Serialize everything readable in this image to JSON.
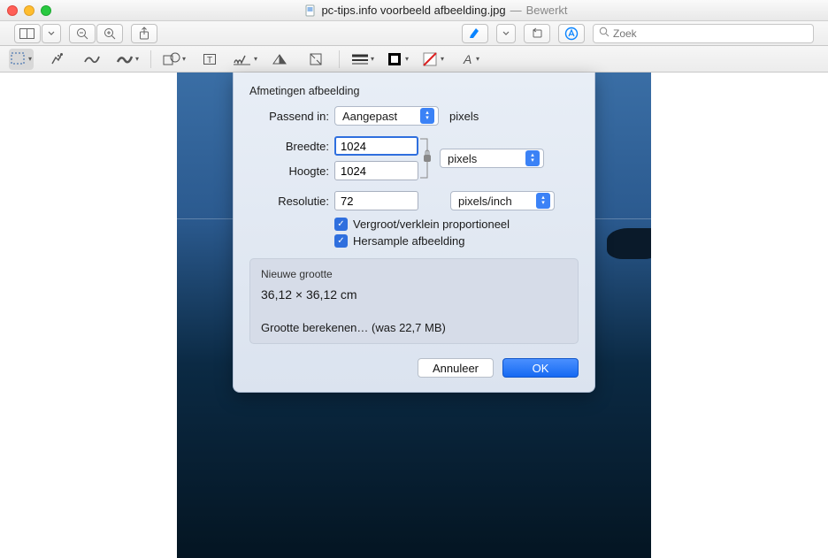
{
  "window": {
    "filename": "pc-tips.info voorbeeld afbeelding.jpg",
    "status_sep": "—",
    "status": "Bewerkt"
  },
  "toolbar": {
    "search_placeholder": "Zoek"
  },
  "dialog": {
    "section_title": "Afmetingen afbeelding",
    "fit_label": "Passend in:",
    "fit_value": "Aangepast",
    "fit_unit": "pixels",
    "width_label": "Breedte:",
    "width_value": "1024",
    "height_label": "Hoogte:",
    "height_value": "1024",
    "size_unit": "pixels",
    "resolution_label": "Resolutie:",
    "resolution_value": "72",
    "resolution_unit": "pixels/inch",
    "scale_proportional": "Vergroot/verklein proportioneel",
    "resample": "Hersample afbeelding",
    "new_size_header": "Nieuwe grootte",
    "new_size_dims": "36,12 × 36,12 cm",
    "new_size_calc": "Grootte berekenen… (was 22,7 MB)",
    "cancel": "Annuleer",
    "ok": "OK"
  }
}
